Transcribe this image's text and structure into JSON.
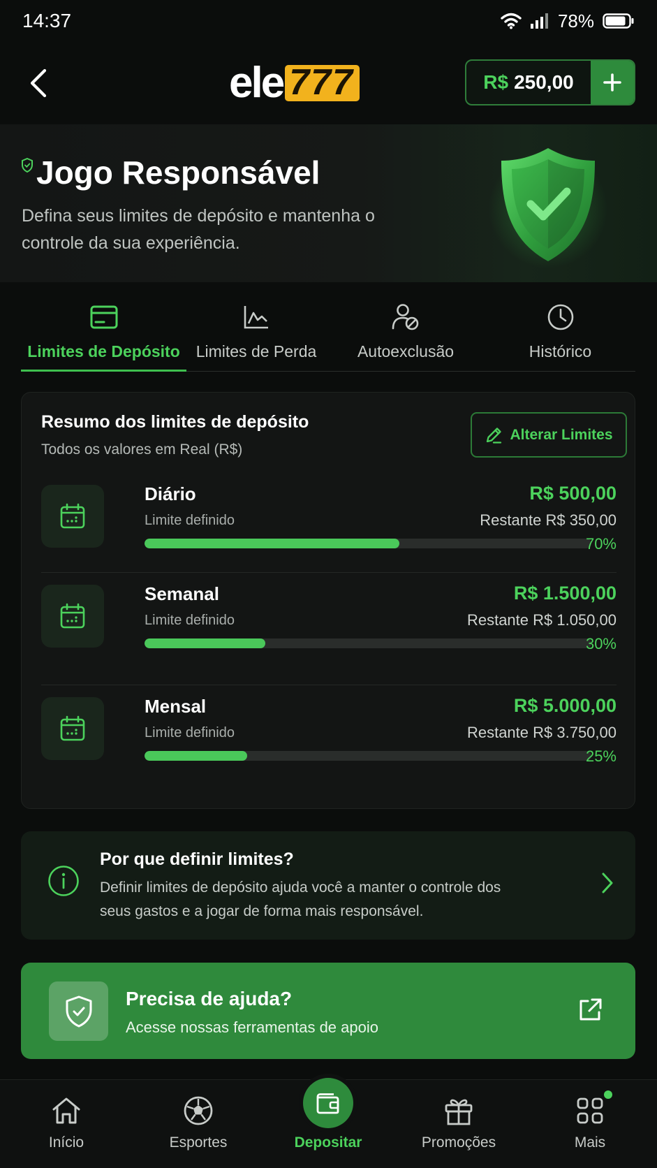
{
  "status_bar": {
    "time": "14:37",
    "battery": "78%"
  },
  "header": {
    "logo_text": "ele",
    "logo_number": "777",
    "balance_currency": "R$",
    "balance_amount": "250,00",
    "add_icon": "plus-icon",
    "back_icon": "chevron-left-icon"
  },
  "hero": {
    "title": "Jogo Responsável",
    "subtitle": "Defina seus limites de depósito e mantenha o controle da sua experiência.",
    "illustration": "shield-check-illustration"
  },
  "tabs": [
    {
      "label": "Limites de Depósito",
      "icon": "card-icon",
      "active": true
    },
    {
      "label": "Limites de Perda",
      "icon": "chart-line-icon",
      "active": false
    },
    {
      "label": "Autoexclusão",
      "icon": "user-block-icon",
      "active": false
    },
    {
      "label": "Histórico",
      "icon": "clock-icon",
      "active": false
    }
  ],
  "summary": {
    "title": "Resumo dos limites de depósito",
    "subtitle": "Todos os valores em Real (R$)",
    "edit_label": "Alterar Limites",
    "limits": [
      {
        "name": "Diário",
        "status": "Limite definido",
        "value": "R$ 500,00",
        "remaining": "Restante R$ 350,00",
        "percent_label": "70%",
        "progress": 0.57
      },
      {
        "name": "Semanal",
        "status": "Limite definido",
        "value": "R$ 1.500,00",
        "remaining": "Restante R$ 1.050,00",
        "percent_label": "30%",
        "progress": 0.27
      },
      {
        "name": "Mensal",
        "status": "Limite definido",
        "value": "R$ 5.000,00",
        "remaining": "Restante R$ 3.750,00",
        "percent_label": "25%",
        "progress": 0.23
      }
    ]
  },
  "info": {
    "title": "Por que definir limites?",
    "text": "Definir limites de depósito ajuda você a manter o controle dos seus gastos e a jogar de forma mais responsável."
  },
  "help": {
    "title": "Precisa de ajuda?",
    "subtitle": "Acesse nossas ferramentas de apoio"
  },
  "bottom_nav": [
    {
      "label": "Início",
      "icon": "home-icon",
      "active": false
    },
    {
      "label": "Esportes",
      "icon": "soccer-ball-icon",
      "active": false
    },
    {
      "label": "Depositar",
      "icon": "wallet-icon",
      "active": true
    },
    {
      "label": "Promoções",
      "icon": "gift-icon",
      "active": false
    },
    {
      "label": "Mais",
      "icon": "grid-icon",
      "active": false
    }
  ],
  "colors": {
    "accent": "#4cd25c",
    "accent_dark": "#2e8b3c",
    "background": "#0b0d0c",
    "logo_yellow": "#f2b21d"
  }
}
